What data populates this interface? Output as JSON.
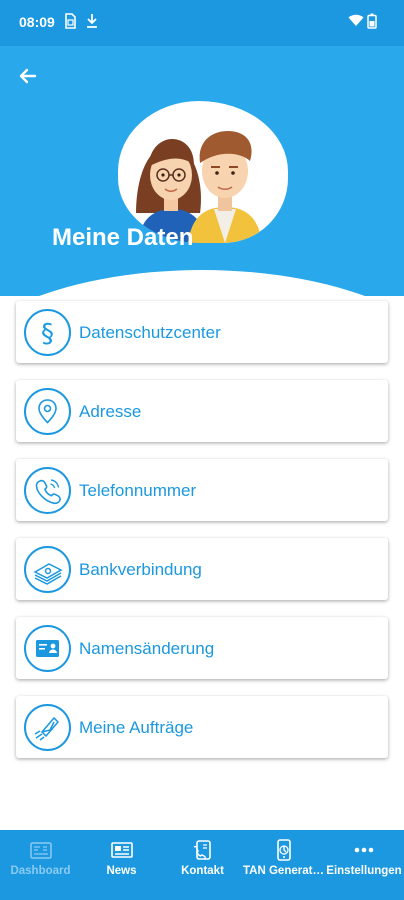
{
  "status_bar": {
    "time": "08:09",
    "icons": [
      "sim-icon",
      "download-icon",
      "wifi-icon",
      "battery-icon"
    ]
  },
  "colors": {
    "accent": "#1b98df",
    "header": "#2aa8ec",
    "tab_inactive": "#8ccbf2",
    "card_bg": "#ffffff"
  },
  "header": {
    "back_icon": "arrow-left-icon",
    "title": "Meine Daten",
    "illustration": "couple-avatar"
  },
  "menu": {
    "items": [
      {
        "label": "Datenschutzcenter",
        "icon": "paragraph-icon"
      },
      {
        "label": "Adresse",
        "icon": "location-pin-icon"
      },
      {
        "label": "Telefonnummer",
        "icon": "phone-icon"
      },
      {
        "label": "Bankverbindung",
        "icon": "money-icon"
      },
      {
        "label": "Namensänderung",
        "icon": "id-card-icon"
      },
      {
        "label": "Meine Aufträge",
        "icon": "send-envelope-icon"
      }
    ]
  },
  "tab_bar": {
    "tabs": [
      {
        "label": "Dashboard",
        "icon": "dashboard-icon",
        "active": false
      },
      {
        "label": "News",
        "icon": "newspaper-icon",
        "active": true
      },
      {
        "label": "Kontakt",
        "icon": "contact-icon",
        "active": true
      },
      {
        "label": "TAN Generat…",
        "icon": "tan-generator-icon",
        "active": true
      },
      {
        "label": "Einstellungen",
        "icon": "more-dots-icon",
        "active": true
      }
    ]
  }
}
